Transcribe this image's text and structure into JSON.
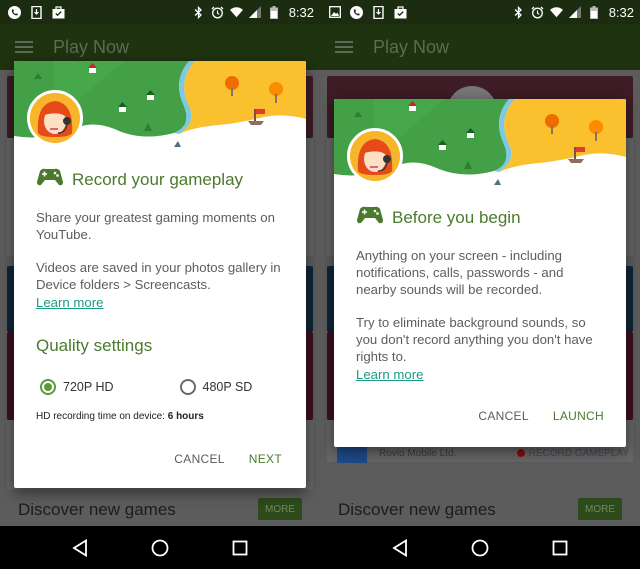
{
  "status_bar": {
    "time": "8:32",
    "left_panel_icons": [
      "phone-icon",
      "download-icon",
      "briefcase-check-icon"
    ],
    "right_panel_icons": [
      "image-icon",
      "phone-icon",
      "download-icon",
      "briefcase-check-icon"
    ],
    "system_icons": [
      "bluetooth-icon",
      "alarm-icon",
      "wifi-icon",
      "signal-icon",
      "battery-icon"
    ]
  },
  "app_bar": {
    "title": "Play Now"
  },
  "background": {
    "discover_title": "Discover new games",
    "more_label": "MORE",
    "publisher": "Rovio Mobile Ltd.",
    "record_gameplay": "RECORD GAMEPLAY"
  },
  "dialog_record": {
    "title": "Record your gameplay",
    "paragraph1": "Share your greatest gaming moments on YouTube.",
    "paragraph2": "Videos are saved in your photos gallery in Device folders > Screencasts.",
    "learn_more": "Learn more",
    "quality_title": "Quality settings",
    "options": [
      {
        "label": "720P HD",
        "selected": true
      },
      {
        "label": "480P SD",
        "selected": false
      }
    ],
    "recording_time_label": "HD recording time on device: ",
    "recording_time_value": "6 hours",
    "cancel_label": "CANCEL",
    "next_label": "NEXT"
  },
  "dialog_before": {
    "title": "Before you begin",
    "paragraph1": "Anything on your screen - including notifications, calls, passwords - and nearby sounds will be recorded.",
    "paragraph2": "Try to eliminate background sounds, so you don't record anything you don't have rights to.",
    "learn_more": "Learn more",
    "cancel_label": "CANCEL",
    "launch_label": "LAUNCH"
  },
  "nav_bar": {
    "buttons": [
      "back-icon",
      "home-icon",
      "recents-icon"
    ]
  },
  "colors": {
    "accent_green": "#4b7a2e",
    "link_teal": "#1a9b86",
    "radio_green": "#5a9a3a",
    "status_bar": "#1c2c10",
    "app_bar_dimmed": "#1f3310"
  }
}
